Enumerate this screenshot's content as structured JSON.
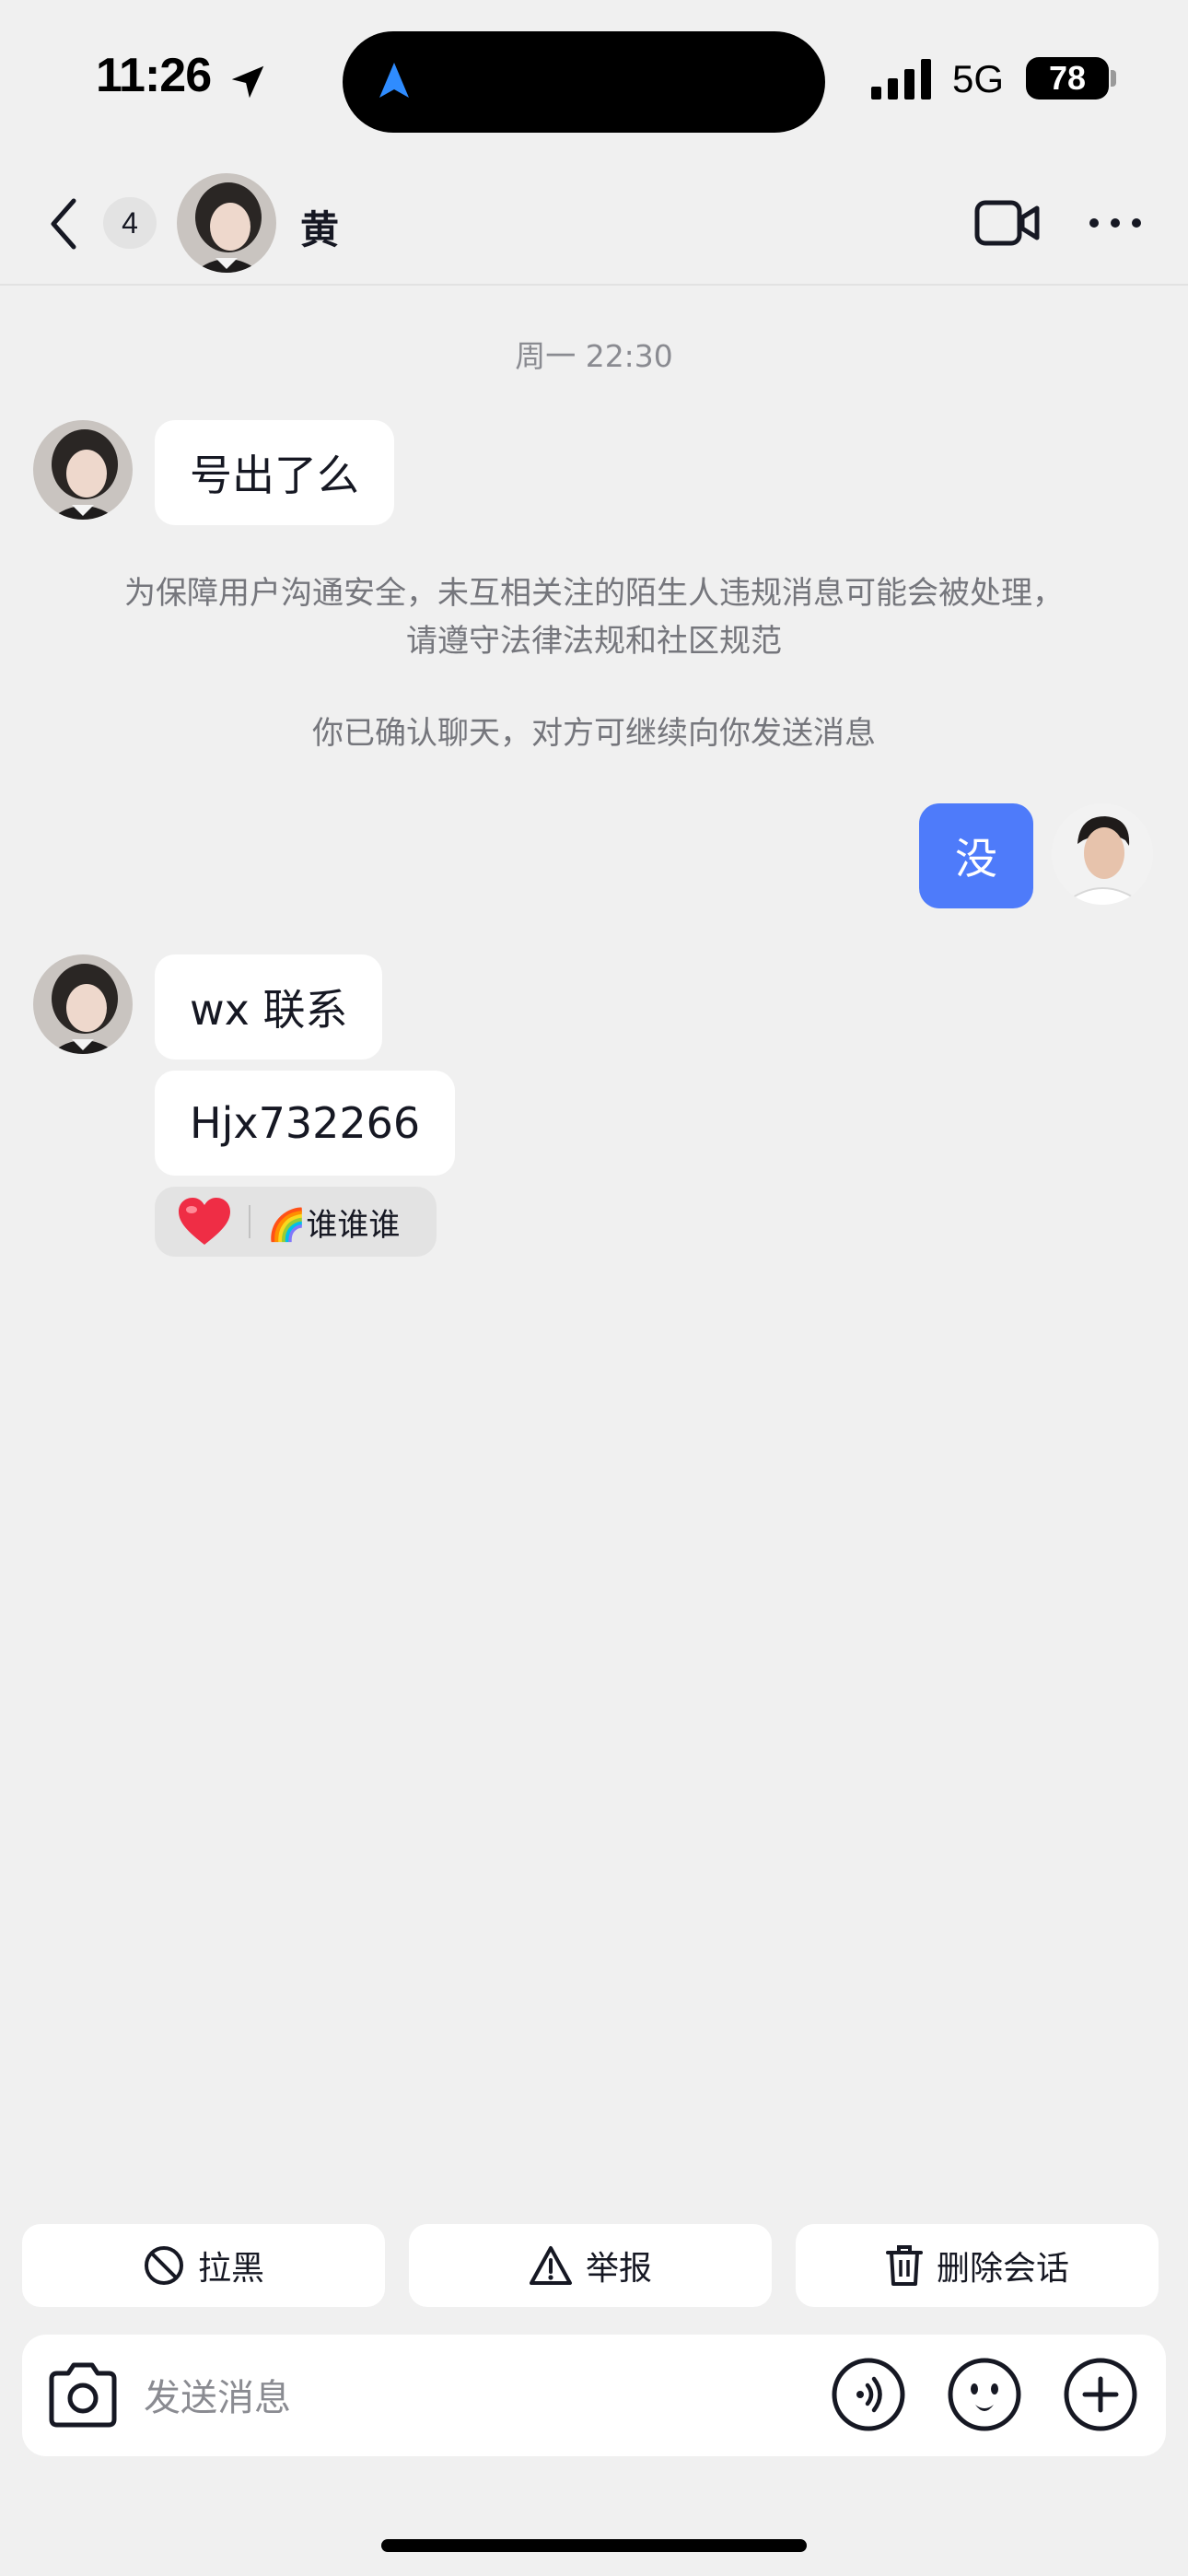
{
  "status_bar": {
    "time": "11:26",
    "network": "5G",
    "battery": "78"
  },
  "header": {
    "unread_count": "4",
    "contact_name": "黄"
  },
  "chat": {
    "timestamp": "周一 22:30",
    "messages": [
      {
        "from": "them",
        "text": "号出了么"
      },
      {
        "from": "me",
        "text": "没"
      },
      {
        "from": "them",
        "text": "wx 联系"
      },
      {
        "from": "them",
        "text": "Hjx732266"
      }
    ],
    "system_notice": "为保障用户沟通安全，未互相关注的陌生人违规消息可能会被处理，请遵守法律法规和社区规范",
    "confirm_notice": "你已确认聊天，对方可继续向你发送消息",
    "reaction": {
      "emoji": "❤️",
      "reactor": "🌈谁谁谁"
    }
  },
  "actions": {
    "block": "拉黑",
    "report": "举报",
    "delete": "删除会话"
  },
  "input": {
    "placeholder": "发送消息"
  },
  "colors": {
    "background": "#f0f0f0",
    "my_bubble": "#4e7bfa",
    "their_bubble": "#ffffff",
    "secondary_text": "#8a8b91"
  },
  "icons": [
    "location-arrow-icon",
    "navigation-icon",
    "signal-icon",
    "back-chevron-icon",
    "video-call-icon",
    "more-icon",
    "block-icon",
    "warning-icon",
    "trash-icon",
    "camera-icon",
    "voice-icon",
    "emoji-icon",
    "plus-icon"
  ]
}
